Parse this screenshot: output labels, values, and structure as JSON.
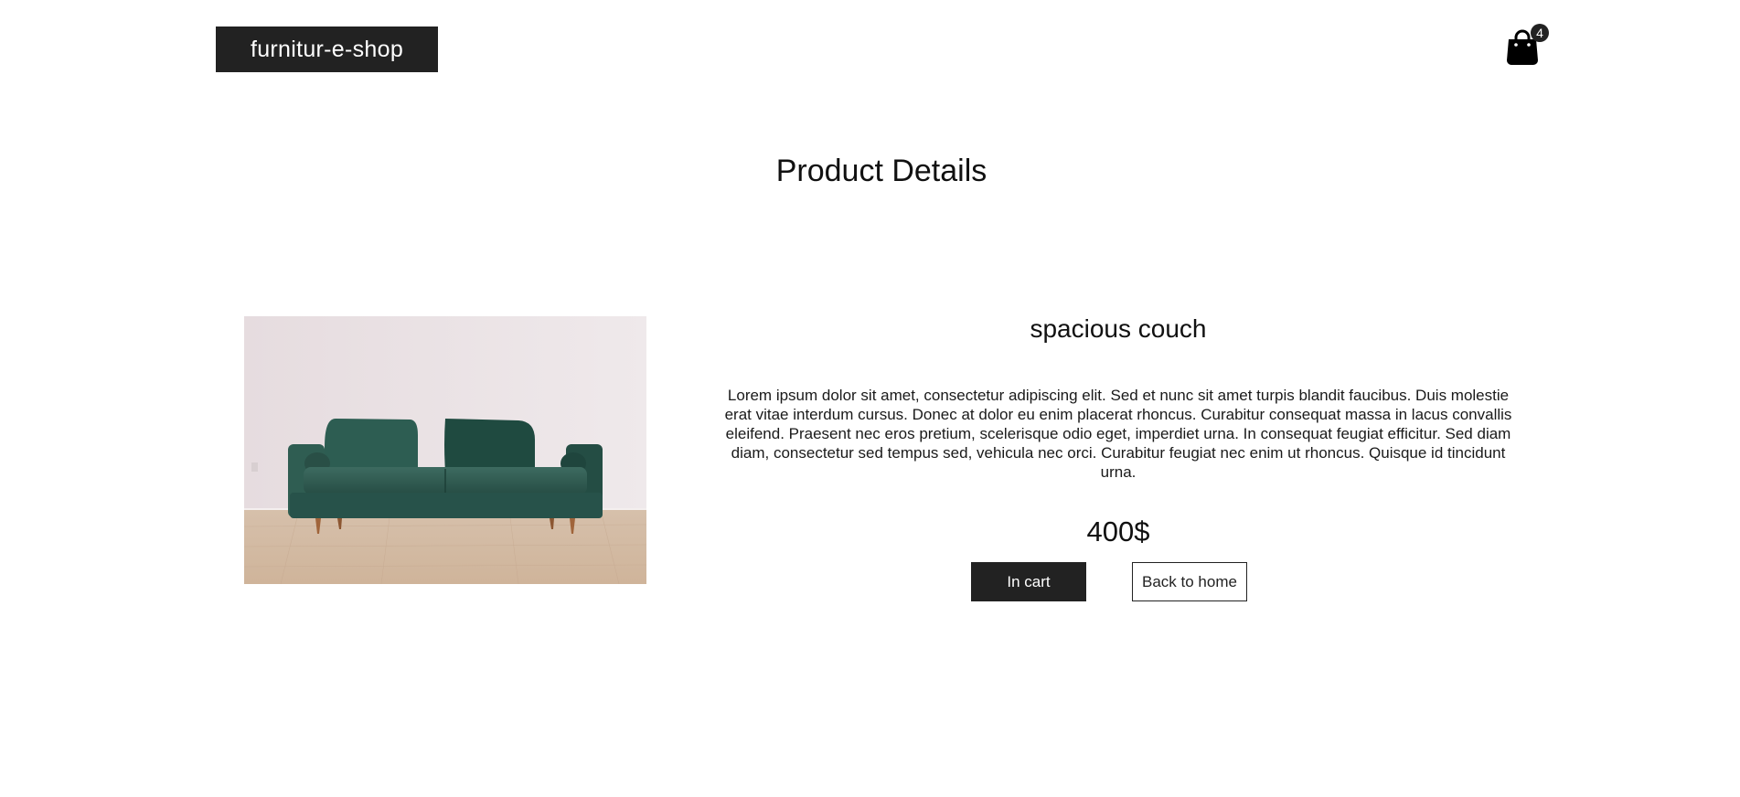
{
  "header": {
    "brand": "furnitur-e-shop",
    "cart": {
      "icon": "shopping-bag-icon",
      "count": "4"
    }
  },
  "main": {
    "title": "Product Details",
    "product": {
      "image": "green-velvet-sofa-photo",
      "name": "spacious couch",
      "description": "Lorem ipsum dolor sit amet, consectetur adipiscing elit. Sed et nunc sit amet turpis blandit faucibus. Duis molestie erat vitae interdum cursus. Donec at dolor eu enim placerat rhoncus. Curabitur consequat massa in lacus convallis eleifend. Praesent nec eros pretium, scelerisque odio eget, imperdiet urna. In consequat feugiat efficitur. Sed diam diam, consectetur sed tempus sed, vehicula nec orci. Curabitur feugiat nec enim ut rhoncus. Quisque id tincidunt urna.",
      "price": "400$"
    },
    "buttons": {
      "in_cart": "In cart",
      "back_home": "Back to home"
    }
  },
  "colors": {
    "primary": "#222222",
    "background": "#ffffff",
    "sofa": "#2f5c51"
  }
}
